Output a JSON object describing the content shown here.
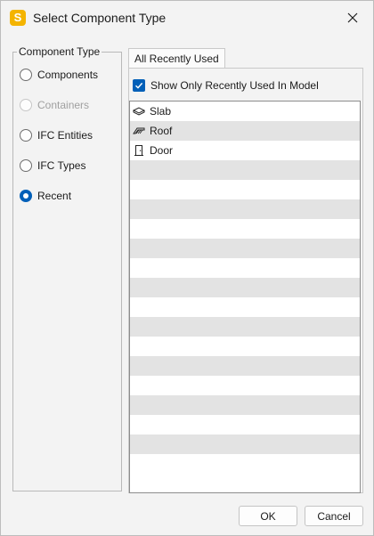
{
  "window": {
    "title": "Select Component Type",
    "app_icon": "S"
  },
  "component_type": {
    "legend": "Component Type",
    "options": [
      {
        "label": "Components",
        "checked": false,
        "disabled": false
      },
      {
        "label": "Containers",
        "checked": false,
        "disabled": true
      },
      {
        "label": "IFC Entities",
        "checked": false,
        "disabled": false
      },
      {
        "label": "IFC Types",
        "checked": false,
        "disabled": false
      },
      {
        "label": "Recent",
        "checked": true,
        "disabled": false
      }
    ]
  },
  "tab": {
    "label": "All Recently Used"
  },
  "filter": {
    "label": "Show Only Recently Used In Model",
    "checked": true
  },
  "list": {
    "items": [
      {
        "label": "Slab",
        "icon": "slab-icon"
      },
      {
        "label": "Roof",
        "icon": "roof-icon"
      },
      {
        "label": "Door",
        "icon": "door-icon"
      }
    ]
  },
  "buttons": {
    "ok": "OK",
    "cancel": "Cancel"
  },
  "colors": {
    "accent": "#005fb8",
    "app_icon": "#f4b400",
    "stripe": "#e3e3e3"
  }
}
